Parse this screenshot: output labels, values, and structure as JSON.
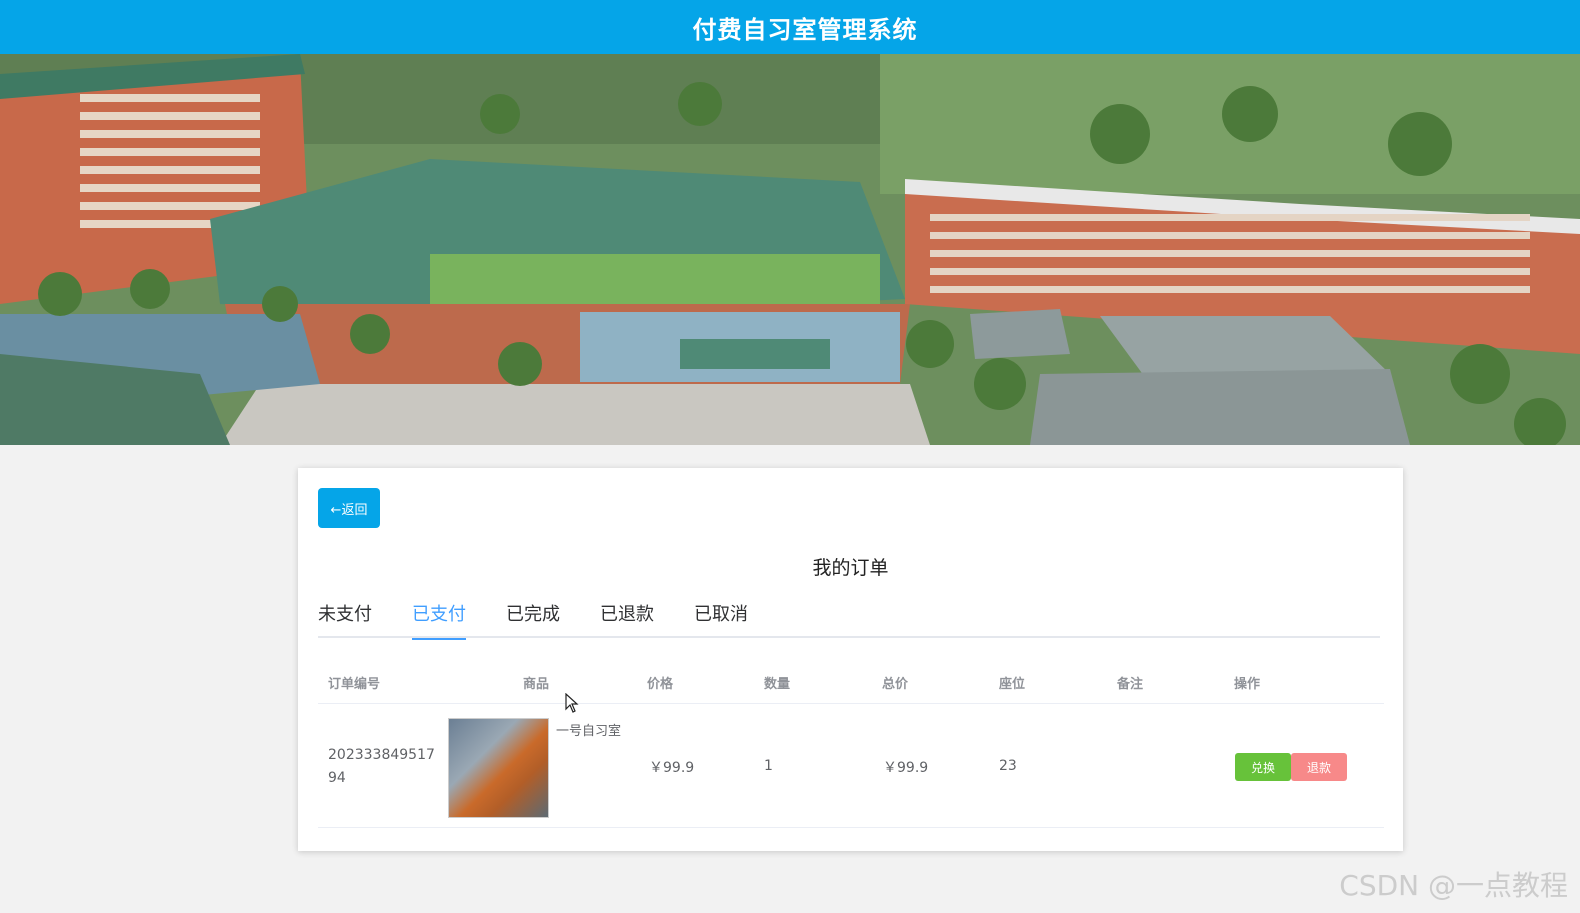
{
  "header": {
    "title": "付费自习室管理系统"
  },
  "banner": {
    "slide_count": 3,
    "active_slide": 1
  },
  "card": {
    "back_label": "←返回",
    "title": "我的订单",
    "tabs": [
      {
        "label": "未支付",
        "active": false
      },
      {
        "label": "已支付",
        "active": true
      },
      {
        "label": "已完成",
        "active": false
      },
      {
        "label": "已退款",
        "active": false
      },
      {
        "label": "已取消",
        "active": false
      }
    ],
    "columns": [
      "订单编号",
      "商品",
      "价格",
      "数量",
      "总价",
      "座位",
      "备注",
      "操作"
    ],
    "rows": [
      {
        "order_no_line1": "202333849517",
        "order_no_line2": "94",
        "product": "一号自习室",
        "price": "￥99.9",
        "quantity": "1",
        "total": "￥99.9",
        "seat": "23",
        "note": "",
        "action_exchange": "兑换",
        "action_refund": "退款"
      }
    ]
  },
  "watermark": "CSDN @一点教程",
  "colors": {
    "primary": "#05a5e8",
    "tab_active": "#409eff",
    "success": "#67c23a",
    "danger": "#f78989"
  }
}
